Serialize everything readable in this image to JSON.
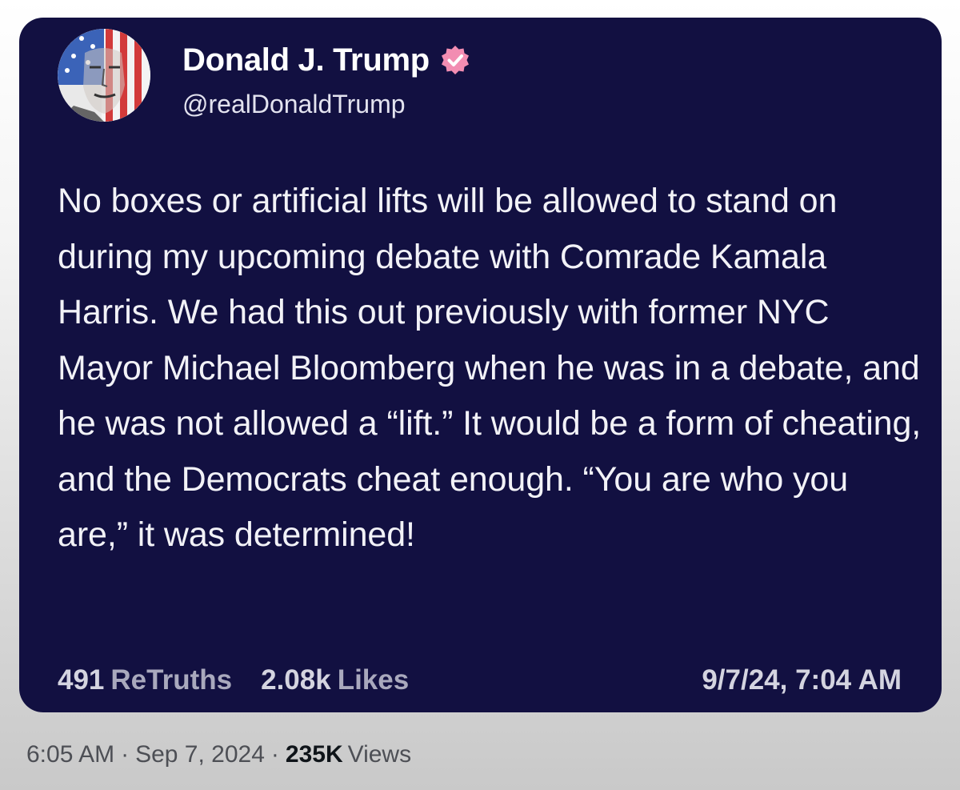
{
  "post": {
    "author_name": "Donald J. Trump",
    "author_handle": "@realDonaldTrump",
    "verified_icon": "verified-badge-icon",
    "avatar_icon": "profile-avatar-flag-portrait",
    "body": "No boxes or artificial lifts will be allowed to stand on during my upcoming debate with Comrade Kamala Harris. We had this out previously with former NYC Mayor Michael Bloomberg when he was in a debate, and he was not allowed a “lift.” It would be a form of cheating, and the Democrats cheat enough. “You are who you are,” it was determined!",
    "retruths_count": "491",
    "retruths_label": "ReTruths",
    "likes_count": "2.08k",
    "likes_label": "Likes",
    "timestamp": "9/7/24, 7:04 AM"
  },
  "tweet_meta": {
    "time": "6:05 AM",
    "separator": "·",
    "date": "Sep 7, 2024",
    "views_count": "235K",
    "views_label": "Views"
  },
  "colors": {
    "card_background": "#121041",
    "verified_badge": "#f28db2",
    "text_primary": "#ffffff",
    "text_muted": "#a9a9bd"
  }
}
